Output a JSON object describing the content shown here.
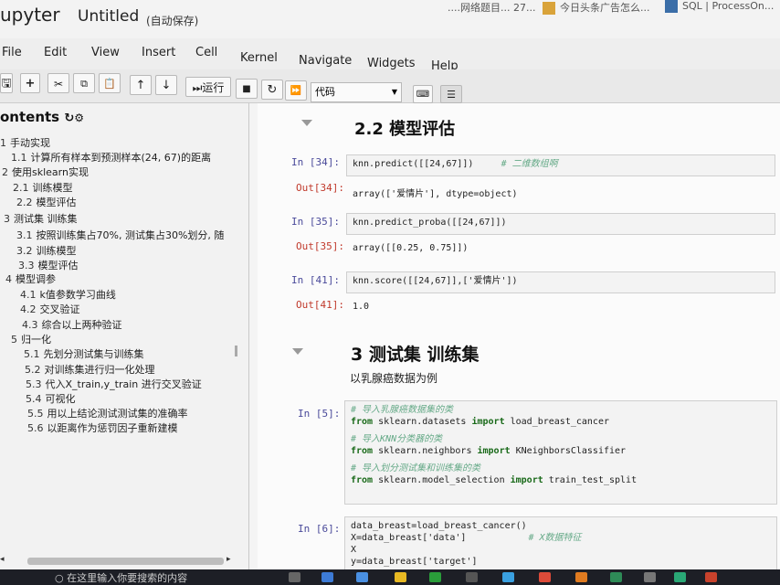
{
  "header": {
    "logo": "upyter",
    "title": "Untitled",
    "autosave": "(自动保存)",
    "bookmarks": [
      "....网络题目... 27...",
      "今日头条广告怎么...",
      "SQL | ProcessOn..."
    ]
  },
  "menu": [
    "File",
    "Edit",
    "View",
    "Insert",
    "Cell",
    "Kernel",
    "Navigate",
    "Widgets",
    "Help"
  ],
  "toolbar": {
    "run_label": "运行",
    "cell_type": "代码"
  },
  "toc": {
    "title": "ontents",
    "items": [
      {
        "num": "1",
        "label": "手动实现"
      },
      {
        "num": "1.1",
        "label": "计算所有样本到预测样本(24, 67)的距离"
      },
      {
        "num": "2",
        "label": "使用sklearn实现"
      },
      {
        "num": "2.1",
        "label": "训练模型"
      },
      {
        "num": "2.2",
        "label": "模型评估"
      },
      {
        "num": "3",
        "label": "测试集 训练集"
      },
      {
        "num": "3.1",
        "label": "按照训练集占70%, 测试集占30%划分, 随"
      },
      {
        "num": "3.2",
        "label": "训练模型"
      },
      {
        "num": "3.3",
        "label": "模型评估"
      },
      {
        "num": "4",
        "label": "模型调参"
      },
      {
        "num": "4.1",
        "label": "k值参数学习曲线"
      },
      {
        "num": "4.2",
        "label": "交叉验证"
      },
      {
        "num": "4.3",
        "label": "综合以上两种验证"
      },
      {
        "num": "5",
        "label": "归一化"
      },
      {
        "num": "5.1",
        "label": "先划分测试集与训练集"
      },
      {
        "num": "5.2",
        "label": "对训练集进行归一化处理"
      },
      {
        "num": "5.3",
        "label": "代入X_train,y_train 进行交叉验证"
      },
      {
        "num": "5.4",
        "label": "可视化"
      },
      {
        "num": "5.5",
        "label": "用以上结论测试测试集的准确率"
      },
      {
        "num": "5.6",
        "label": "以距离作为惩罚因子重新建模"
      }
    ]
  },
  "notebook": {
    "heading1": "2.2  模型评估",
    "cell34_in": "In  [34]:",
    "cell34_code": "knn.predict([[24,67]])",
    "cell34_comment": "# 二维数组啊",
    "cell34_out": "Out[34]:",
    "cell34_result": "array(['爱情片'], dtype=object)",
    "cell35_in": "In  [35]:",
    "cell35_code": "knn.predict_proba([[24,67]])",
    "cell35_out": "Out[35]:",
    "cell35_result": "array([[0.25, 0.75]])",
    "cell41_in": "In  [41]:",
    "cell41_code": "knn.score([[24,67]],['爱情片'])",
    "cell41_out": "Out[41]:",
    "cell41_result": "1.0",
    "heading2": "3  测试集 训练集",
    "subtext": "以乳腺癌数据为例",
    "cell5_in": "In  [5]:",
    "cell5_lines": [
      {
        "comment": "# 导入乳腺癌数据集的类"
      },
      {
        "kw1": "from",
        "mod": " sklearn.datasets ",
        "kw2": "import",
        "name": " load_breast_cancer"
      },
      {
        "comment": "# 导入KNN分类器的类"
      },
      {
        "kw1": "from",
        "mod": " sklearn.neighbors ",
        "kw2": "import",
        "name": " KNeighborsClassifier"
      },
      {
        "comment": "# 导入划分测试集和训练集的类"
      },
      {
        "kw1": "from",
        "mod": " sklearn.model_selection ",
        "kw2": "import",
        "name": " train_test_split"
      }
    ],
    "cell6_in": "In  [6]:",
    "cell6_lines": [
      "data_breast=load_breast_cancer()",
      "X=data_breast['data']",
      "X",
      "y=data_breast['target']"
    ],
    "cell6_comment": "# X数据特征"
  },
  "taskbar": {
    "search_text": "在这里输入你要搜索的内容"
  }
}
